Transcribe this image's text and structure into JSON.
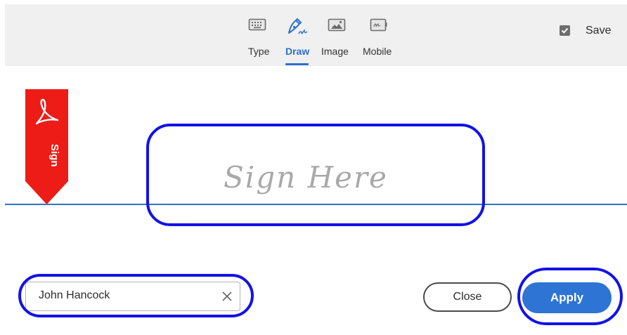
{
  "tabs": [
    {
      "label": "Type",
      "icon": "keyboard-icon",
      "active": false
    },
    {
      "label": "Draw",
      "icon": "pen-icon",
      "active": true
    },
    {
      "label": "Image",
      "icon": "image-icon",
      "active": false
    },
    {
      "label": "Mobile",
      "icon": "mobile-icon",
      "active": false
    }
  ],
  "save": {
    "label": "Save",
    "checked": true
  },
  "sign_flag": {
    "label": "Sign",
    "icon": "acrobat-logo-icon",
    "color": "#ed1c16"
  },
  "signature": {
    "placeholder": "Sign Here"
  },
  "name_field": {
    "value": "John Hancock"
  },
  "buttons": {
    "close": "Close",
    "apply": "Apply"
  },
  "colors": {
    "accent": "#2c6fcc",
    "apply_bg": "#2d74d4",
    "highlight_ring": "#1212e6",
    "baseline": "#2d74c7",
    "toolbar_bg": "#f0f0f0"
  }
}
